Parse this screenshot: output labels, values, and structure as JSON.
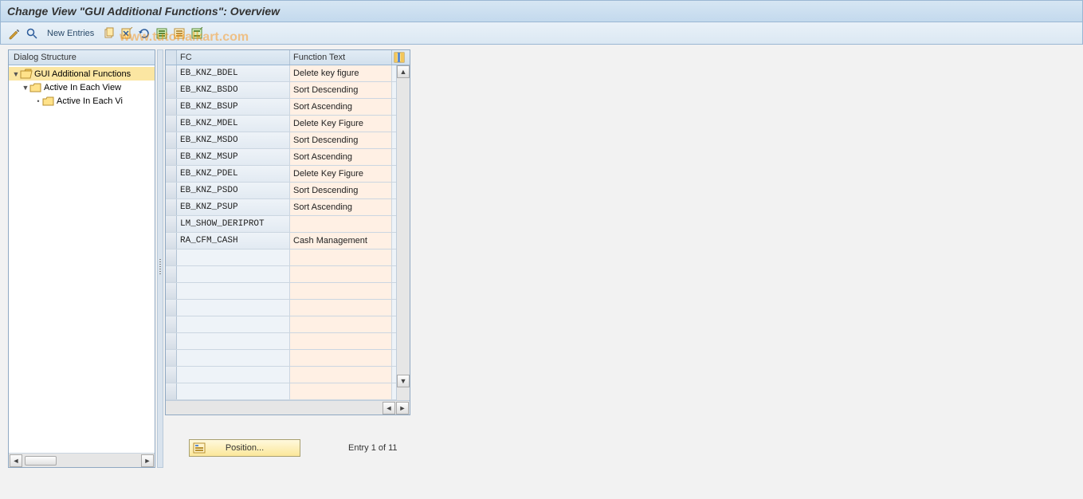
{
  "title": "Change View \"GUI Additional Functions\": Overview",
  "toolbar": {
    "new_entries": "New Entries"
  },
  "watermark": "www.tutorialkart.com",
  "tree": {
    "header": "Dialog Structure",
    "n0": "GUI Additional Functions",
    "n1": "Active In Each View",
    "n2": "Active In Each Vi"
  },
  "grid": {
    "col_fc": "FC",
    "col_ft": "Function Text",
    "rows": [
      {
        "fc": "EB_KNZ_BDEL",
        "ft": "Delete key figure"
      },
      {
        "fc": "EB_KNZ_BSDO",
        "ft": "Sort Descending"
      },
      {
        "fc": "EB_KNZ_BSUP",
        "ft": "Sort Ascending"
      },
      {
        "fc": "EB_KNZ_MDEL",
        "ft": "Delete Key Figure"
      },
      {
        "fc": "EB_KNZ_MSDO",
        "ft": "Sort Descending"
      },
      {
        "fc": "EB_KNZ_MSUP",
        "ft": "Sort Ascending"
      },
      {
        "fc": "EB_KNZ_PDEL",
        "ft": "Delete Key Figure"
      },
      {
        "fc": "EB_KNZ_PSDO",
        "ft": "Sort Descending"
      },
      {
        "fc": "EB_KNZ_PSUP",
        "ft": "Sort Ascending"
      },
      {
        "fc": "LM_SHOW_DERIPROT",
        "ft": ""
      },
      {
        "fc": "RA_CFM_CASH",
        "ft": "Cash Management"
      }
    ]
  },
  "footer": {
    "position_btn": "Position...",
    "entry_count": "Entry 1 of 11"
  }
}
